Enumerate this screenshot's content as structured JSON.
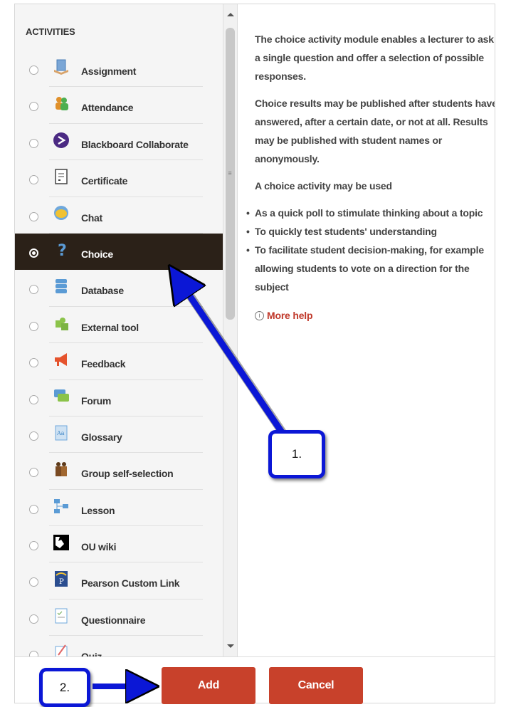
{
  "activities": {
    "heading": "ACTIVITIES",
    "items": [
      {
        "label": "Assignment",
        "icon": "assignment-icon",
        "selected": false
      },
      {
        "label": "Attendance",
        "icon": "attendance-icon",
        "selected": false
      },
      {
        "label": "Blackboard Collaborate",
        "icon": "blackboard-collaborate-icon",
        "selected": false
      },
      {
        "label": "Certificate",
        "icon": "certificate-icon",
        "selected": false
      },
      {
        "label": "Chat",
        "icon": "chat-icon",
        "selected": false
      },
      {
        "label": "Choice",
        "icon": "question-mark-icon",
        "selected": true
      },
      {
        "label": "Database",
        "icon": "database-icon",
        "selected": false
      },
      {
        "label": "External tool",
        "icon": "puzzle-icon",
        "selected": false
      },
      {
        "label": "Feedback",
        "icon": "megaphone-icon",
        "selected": false
      },
      {
        "label": "Forum",
        "icon": "forum-icon",
        "selected": false
      },
      {
        "label": "Glossary",
        "icon": "glossary-icon",
        "selected": false
      },
      {
        "label": "Group self-selection",
        "icon": "group-icon",
        "selected": false
      },
      {
        "label": "Lesson",
        "icon": "lesson-icon",
        "selected": false
      },
      {
        "label": "OU wiki",
        "icon": "wiki-icon",
        "selected": false
      },
      {
        "label": "Pearson Custom Link",
        "icon": "pearson-icon",
        "selected": false
      },
      {
        "label": "Questionnaire",
        "icon": "questionnaire-icon",
        "selected": false
      },
      {
        "label": "Quiz",
        "icon": "quiz-icon",
        "selected": false
      }
    ]
  },
  "help": {
    "p1": "The choice activity module enables a lecturer to ask a single question and offer a selection of possible responses.",
    "p2": "Choice results may be published after students have answered, after a certain date, or not at all. Results may be published with student names or anonymously.",
    "p3": "A choice activity may be used",
    "bullets": [
      "As a quick poll to stimulate thinking about a topic",
      "To quickly test students' understanding",
      "To facilitate student decision-making, for example allowing students to vote on a direction for the subject"
    ],
    "more_help": "More help"
  },
  "footer": {
    "add_label": "Add",
    "cancel_label": "Cancel"
  },
  "annotations": {
    "callout1": "1.",
    "callout2": "2."
  },
  "colors": {
    "selected_bg": "#2b2118",
    "button_red": "#c8412b",
    "annotation_blue": "#0b17d6",
    "link_red": "#c0392b"
  }
}
